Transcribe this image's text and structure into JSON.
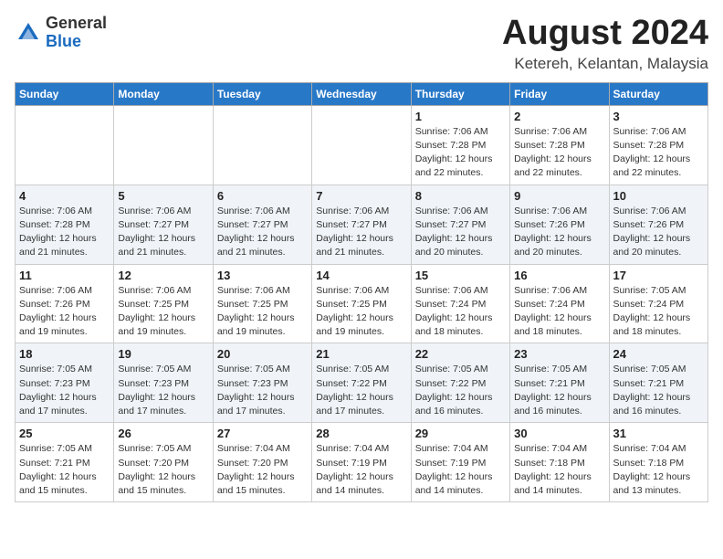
{
  "header": {
    "logo": {
      "general": "General",
      "blue": "Blue"
    },
    "month_year": "August 2024",
    "location": "Ketereh, Kelantan, Malaysia"
  },
  "weekdays": [
    "Sunday",
    "Monday",
    "Tuesday",
    "Wednesday",
    "Thursday",
    "Friday",
    "Saturday"
  ],
  "weeks": [
    [
      {
        "day": "",
        "sunrise": "",
        "sunset": "",
        "daylight": ""
      },
      {
        "day": "",
        "sunrise": "",
        "sunset": "",
        "daylight": ""
      },
      {
        "day": "",
        "sunrise": "",
        "sunset": "",
        "daylight": ""
      },
      {
        "day": "",
        "sunrise": "",
        "sunset": "",
        "daylight": ""
      },
      {
        "day": "1",
        "sunrise": "7:06 AM",
        "sunset": "7:28 PM",
        "daylight": "12 hours and 22 minutes."
      },
      {
        "day": "2",
        "sunrise": "7:06 AM",
        "sunset": "7:28 PM",
        "daylight": "12 hours and 22 minutes."
      },
      {
        "day": "3",
        "sunrise": "7:06 AM",
        "sunset": "7:28 PM",
        "daylight": "12 hours and 22 minutes."
      }
    ],
    [
      {
        "day": "4",
        "sunrise": "7:06 AM",
        "sunset": "7:28 PM",
        "daylight": "12 hours and 21 minutes."
      },
      {
        "day": "5",
        "sunrise": "7:06 AM",
        "sunset": "7:27 PM",
        "daylight": "12 hours and 21 minutes."
      },
      {
        "day": "6",
        "sunrise": "7:06 AM",
        "sunset": "7:27 PM",
        "daylight": "12 hours and 21 minutes."
      },
      {
        "day": "7",
        "sunrise": "7:06 AM",
        "sunset": "7:27 PM",
        "daylight": "12 hours and 21 minutes."
      },
      {
        "day": "8",
        "sunrise": "7:06 AM",
        "sunset": "7:27 PM",
        "daylight": "12 hours and 20 minutes."
      },
      {
        "day": "9",
        "sunrise": "7:06 AM",
        "sunset": "7:26 PM",
        "daylight": "12 hours and 20 minutes."
      },
      {
        "day": "10",
        "sunrise": "7:06 AM",
        "sunset": "7:26 PM",
        "daylight": "12 hours and 20 minutes."
      }
    ],
    [
      {
        "day": "11",
        "sunrise": "7:06 AM",
        "sunset": "7:26 PM",
        "daylight": "12 hours and 19 minutes."
      },
      {
        "day": "12",
        "sunrise": "7:06 AM",
        "sunset": "7:25 PM",
        "daylight": "12 hours and 19 minutes."
      },
      {
        "day": "13",
        "sunrise": "7:06 AM",
        "sunset": "7:25 PM",
        "daylight": "12 hours and 19 minutes."
      },
      {
        "day": "14",
        "sunrise": "7:06 AM",
        "sunset": "7:25 PM",
        "daylight": "12 hours and 19 minutes."
      },
      {
        "day": "15",
        "sunrise": "7:06 AM",
        "sunset": "7:24 PM",
        "daylight": "12 hours and 18 minutes."
      },
      {
        "day": "16",
        "sunrise": "7:06 AM",
        "sunset": "7:24 PM",
        "daylight": "12 hours and 18 minutes."
      },
      {
        "day": "17",
        "sunrise": "7:05 AM",
        "sunset": "7:24 PM",
        "daylight": "12 hours and 18 minutes."
      }
    ],
    [
      {
        "day": "18",
        "sunrise": "7:05 AM",
        "sunset": "7:23 PM",
        "daylight": "12 hours and 17 minutes."
      },
      {
        "day": "19",
        "sunrise": "7:05 AM",
        "sunset": "7:23 PM",
        "daylight": "12 hours and 17 minutes."
      },
      {
        "day": "20",
        "sunrise": "7:05 AM",
        "sunset": "7:23 PM",
        "daylight": "12 hours and 17 minutes."
      },
      {
        "day": "21",
        "sunrise": "7:05 AM",
        "sunset": "7:22 PM",
        "daylight": "12 hours and 17 minutes."
      },
      {
        "day": "22",
        "sunrise": "7:05 AM",
        "sunset": "7:22 PM",
        "daylight": "12 hours and 16 minutes."
      },
      {
        "day": "23",
        "sunrise": "7:05 AM",
        "sunset": "7:21 PM",
        "daylight": "12 hours and 16 minutes."
      },
      {
        "day": "24",
        "sunrise": "7:05 AM",
        "sunset": "7:21 PM",
        "daylight": "12 hours and 16 minutes."
      }
    ],
    [
      {
        "day": "25",
        "sunrise": "7:05 AM",
        "sunset": "7:21 PM",
        "daylight": "12 hours and 15 minutes."
      },
      {
        "day": "26",
        "sunrise": "7:05 AM",
        "sunset": "7:20 PM",
        "daylight": "12 hours and 15 minutes."
      },
      {
        "day": "27",
        "sunrise": "7:04 AM",
        "sunset": "7:20 PM",
        "daylight": "12 hours and 15 minutes."
      },
      {
        "day": "28",
        "sunrise": "7:04 AM",
        "sunset": "7:19 PM",
        "daylight": "12 hours and 14 minutes."
      },
      {
        "day": "29",
        "sunrise": "7:04 AM",
        "sunset": "7:19 PM",
        "daylight": "12 hours and 14 minutes."
      },
      {
        "day": "30",
        "sunrise": "7:04 AM",
        "sunset": "7:18 PM",
        "daylight": "12 hours and 14 minutes."
      },
      {
        "day": "31",
        "sunrise": "7:04 AM",
        "sunset": "7:18 PM",
        "daylight": "12 hours and 13 minutes."
      }
    ]
  ]
}
